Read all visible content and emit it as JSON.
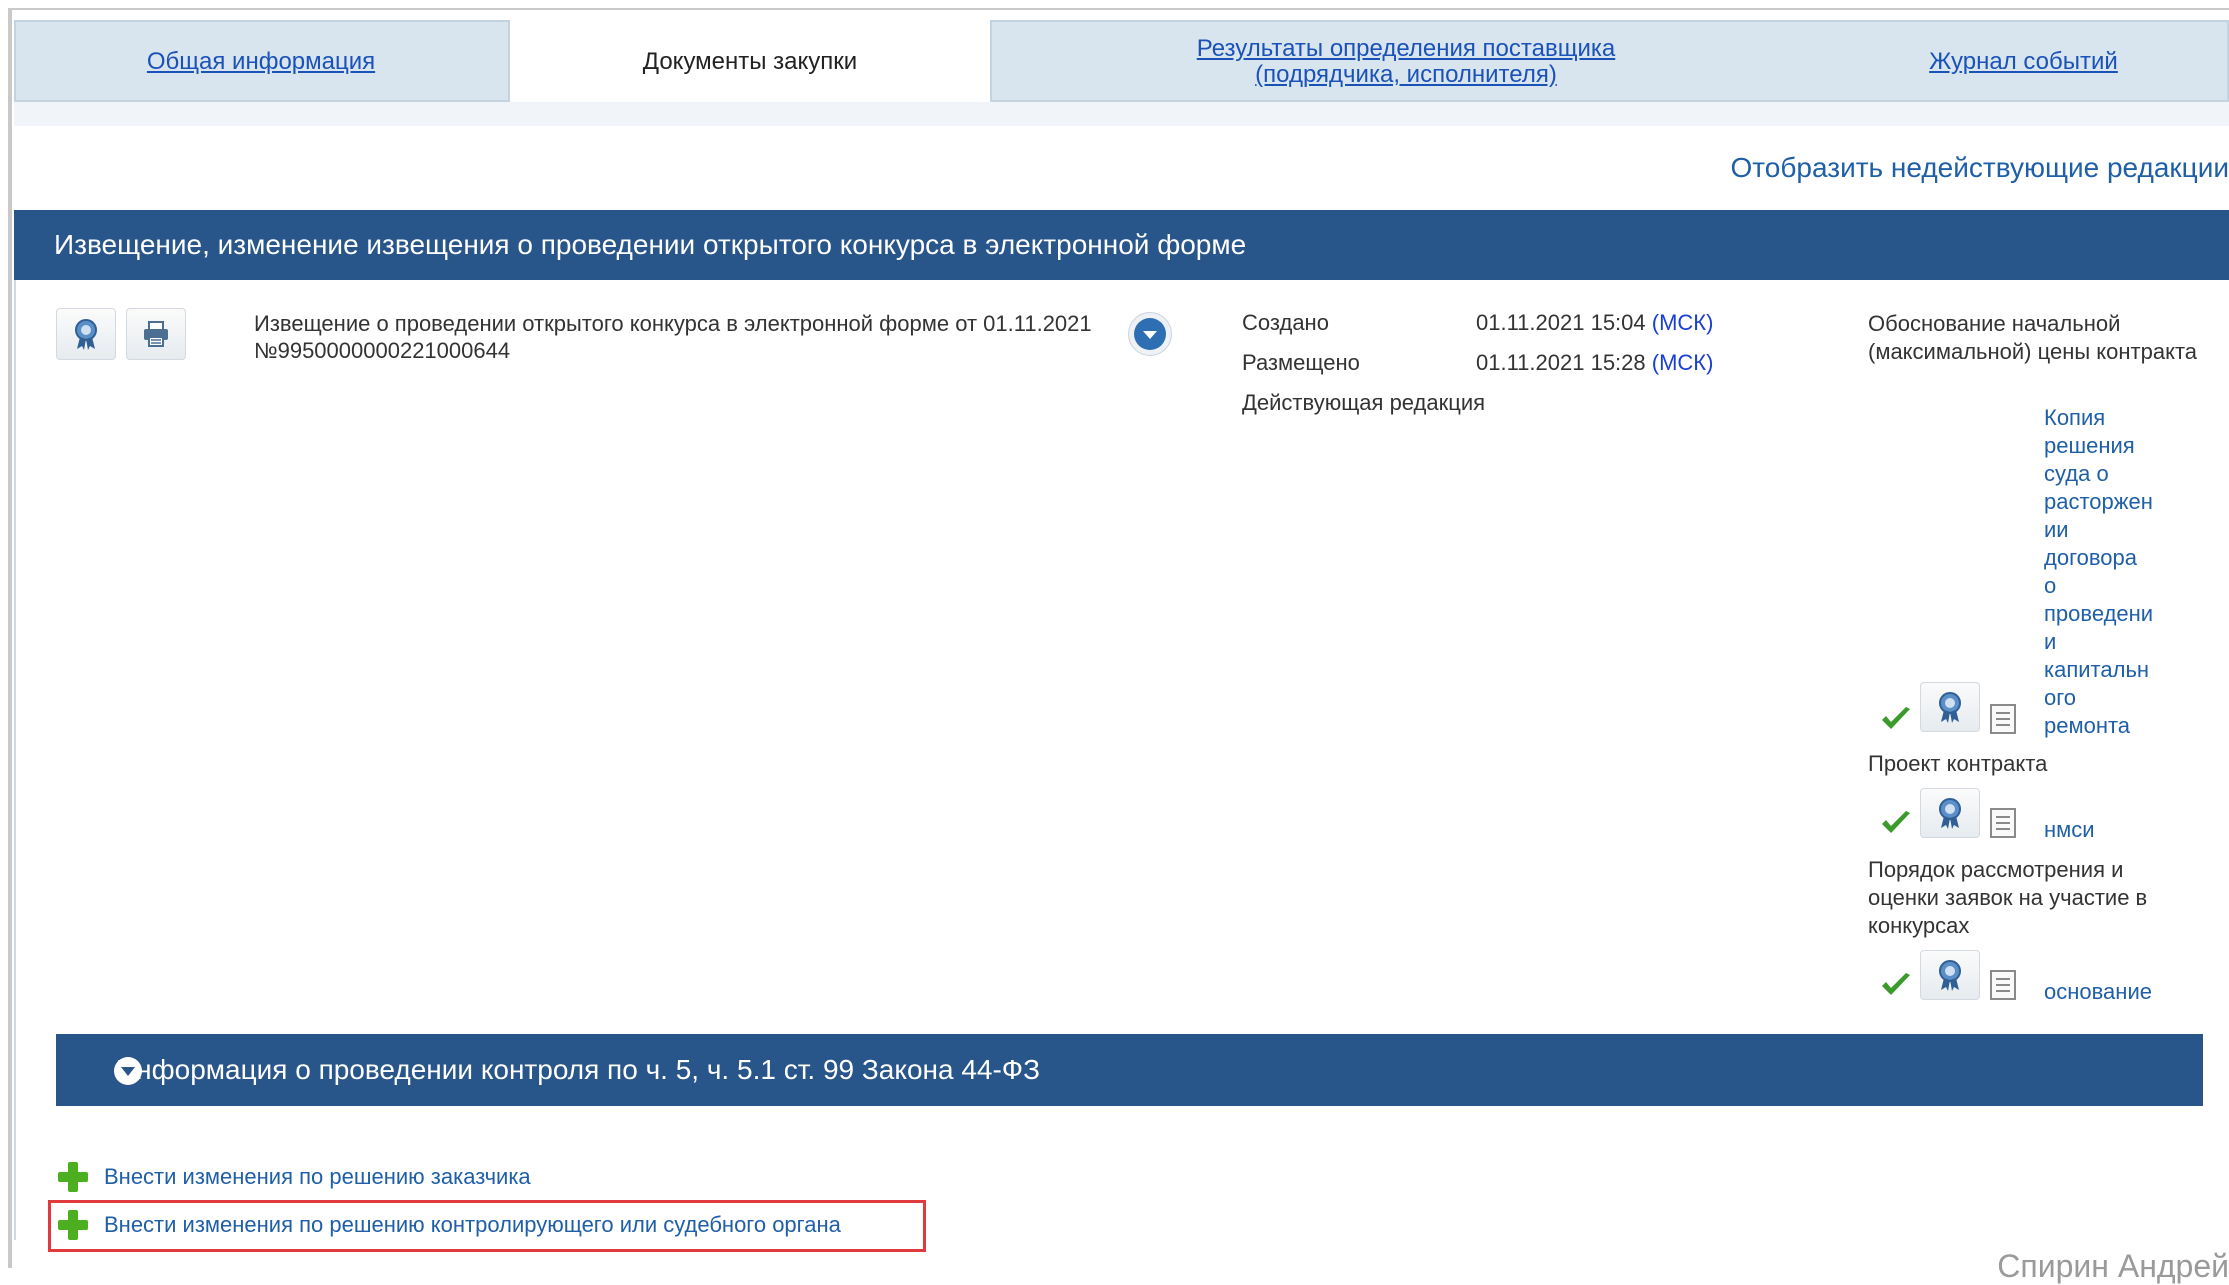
{
  "tabs": [
    {
      "label": "Общая информация",
      "active": false
    },
    {
      "label": "Документы закупки",
      "active": true
    },
    {
      "label_line1": "Результаты определения поставщика",
      "label_line2": "(подрядчика, исполнителя)",
      "active": false
    },
    {
      "label": "Журнал событий",
      "active": false
    }
  ],
  "show_inactive_link": "Отобразить недействующие редакции",
  "panel": {
    "title": "Извещение, изменение извещения о проведении открытого конкурса в электронной форме",
    "notice_text": "Извещение о проведении открытого конкурса в электронной форме от 01.11.2021 №9950000000221000644",
    "created_label": "Создано",
    "created_value": "01.11.2021 15:04",
    "placed_label": "Размещено",
    "placed_value": "01.11.2021 15:28",
    "tz": "(МСК)",
    "status": "Действующая редакция"
  },
  "documents": [
    {
      "title": "Обоснование начальной (максимальной) цены контракта",
      "link_lines": [
        "Копия",
        "решения",
        "суда о",
        "расторжен",
        "ии",
        "договора",
        "о",
        "проведени",
        "и",
        "капитальн",
        "ого",
        "ремонта"
      ]
    },
    {
      "title": "Проект контракта",
      "link_lines": [
        "нмси"
      ]
    },
    {
      "title": "Порядок рассмотрения и оценки заявок на участие в конкурсах",
      "link_lines": [
        "основание"
      ]
    }
  ],
  "control_section_title": "Информация о проведении контроля по ч. 5, ч. 5.1 ст. 99 Закона 44-ФЗ",
  "actions": [
    {
      "label": "Внести изменения по решению заказчика"
    },
    {
      "label": "Внести изменения по решению контролирующего или судебного органа"
    }
  ],
  "watermark": "Спирин Андрей",
  "colors": {
    "header_bg": "#28568a",
    "link": "#1f5fa8",
    "highlight": "#e0393e",
    "check": "#3a9a2a",
    "plus": "#4caf1f"
  },
  "icons": [
    "certificate-icon",
    "print-icon",
    "chevron-down-icon",
    "checkmark-icon",
    "document-icon",
    "plus-icon"
  ]
}
